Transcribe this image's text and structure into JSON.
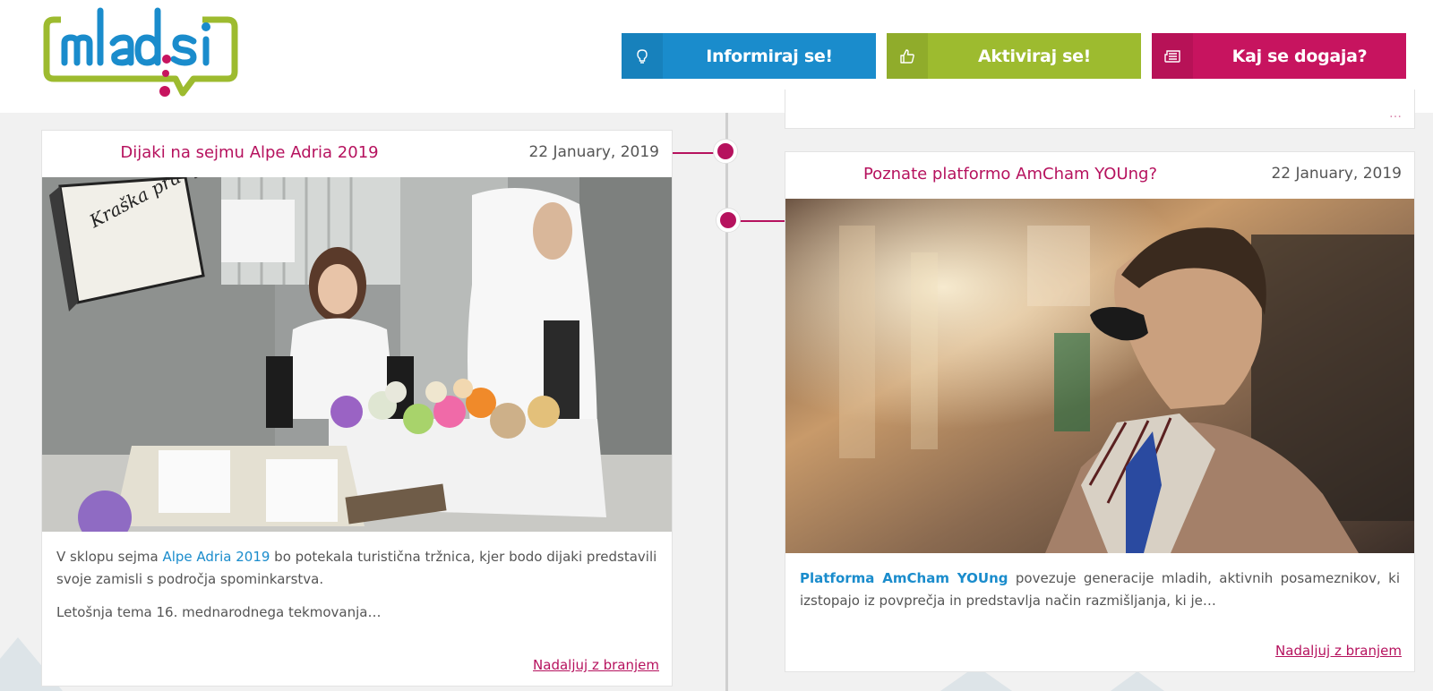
{
  "header": {
    "logo_text": "mlad.si",
    "nav": [
      {
        "label": "Informiraj se!",
        "icon": "lightbulb-icon",
        "color": "#1a8ccc"
      },
      {
        "label": "Aktiviraj se!",
        "icon": "thumbs-up-icon",
        "color": "#9dbb2f"
      },
      {
        "label": "Kaj se dogaja?",
        "icon": "newspaper-icon",
        "color": "#c7145f"
      }
    ]
  },
  "colors": {
    "accent": "#b6125e",
    "link": "#1a8ccc"
  },
  "posts": [
    {
      "title": "Dijaki na sejmu Alpe Adria 2019",
      "date": "22 January, 2019",
      "p1_before": "V sklopu sejma ",
      "p1_link": "Alpe Adria 2019",
      "p1_after": " bo potekala turistična tržnica, kjer bodo dijaki predstavili svoje zamisli s področja spominkarstva.",
      "p2": "Letošnja tema 16. mednarodnega  tekmovanja…",
      "read_more": "Nadaljuj z branjem",
      "image_book_title": "Kraška pravljica"
    },
    {
      "title": "Poznate platformo AmCham YOUng?",
      "date": "22 January, 2019",
      "p1_link": "Platforma AmCham YOUng",
      "p1_after": " povezuje generacije mladih, aktivnih posameznikov, ki izstopajo iz povprečja in predstavlja način razmišljanja, ki je…",
      "read_more": "Nadaljuj z branjem"
    }
  ]
}
